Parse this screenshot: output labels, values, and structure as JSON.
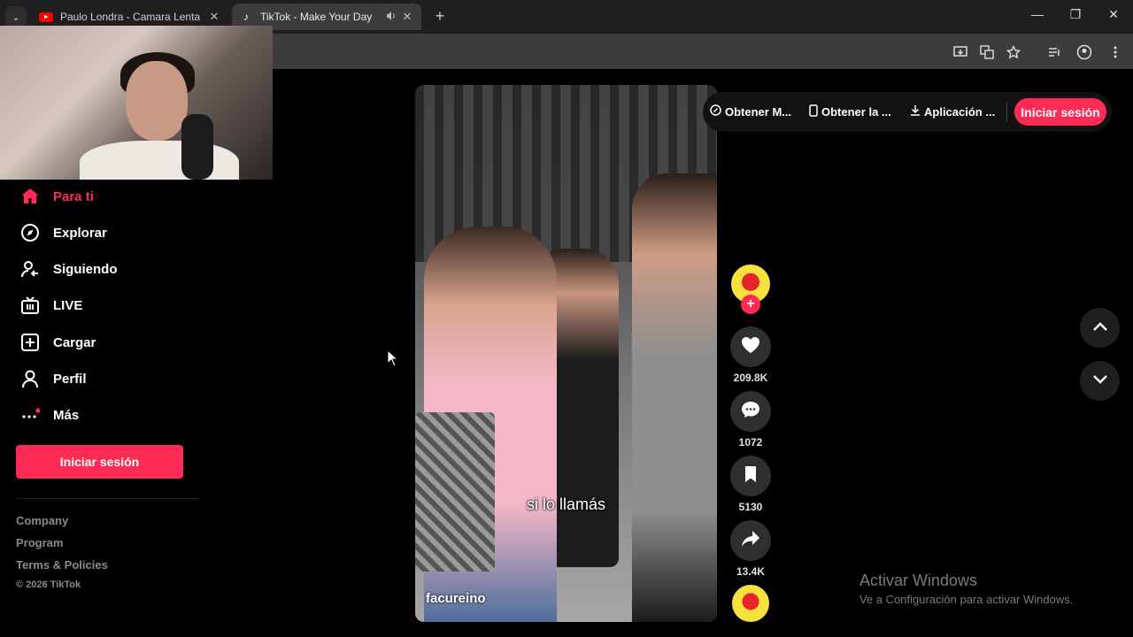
{
  "browser": {
    "tabs": [
      {
        "title": "Paulo Londra - Camara Lenta (C",
        "icon": "youtube-icon",
        "active": false
      },
      {
        "title": "TikTok - Make Your Day",
        "icon": "tiktok-icon",
        "active": true
      }
    ],
    "new_tab": "+",
    "window_controls": {
      "minimize": "—",
      "restore": "❐",
      "close": "✕"
    },
    "tab_close": "✕",
    "dropdown": "⌄",
    "audio": "🔊"
  },
  "sidebar": {
    "items": [
      {
        "label": "Para ti",
        "icon": "home-icon",
        "active": true
      },
      {
        "label": "Explorar",
        "icon": "compass-icon",
        "active": false
      },
      {
        "label": "Siguiendo",
        "icon": "following-icon",
        "active": false
      },
      {
        "label": "LIVE",
        "icon": "live-icon",
        "active": false
      },
      {
        "label": "Cargar",
        "icon": "upload-icon",
        "active": false
      },
      {
        "label": "Perfil",
        "icon": "profile-icon",
        "active": false
      },
      {
        "label": "Más",
        "icon": "more-icon",
        "active": false
      }
    ],
    "login_label": "Iniciar sesión",
    "footer_links": [
      "Company",
      "Program",
      "Terms & Policies"
    ],
    "copyright": "© 2026 TikTok"
  },
  "header": {
    "links": [
      {
        "label": "Obtener M...",
        "icon": "coin-icon"
      },
      {
        "label": "Obtener la ...",
        "icon": "phone-icon"
      },
      {
        "label": "Aplicación ...",
        "icon": "download-icon"
      }
    ],
    "login_label": "Iniciar sesión"
  },
  "video": {
    "caption": "si lo llamás",
    "author": "facureino"
  },
  "actions": {
    "likes": "209.8K",
    "comments": "1072",
    "saves": "5130",
    "shares": "13.4K"
  },
  "watermark": {
    "title": "Activar Windows",
    "subtitle": "Ve a Configuración para activar Windows."
  },
  "colors": {
    "accent": "#fe2c55",
    "background": "#000000",
    "muted_text": "#8a8a8a"
  }
}
